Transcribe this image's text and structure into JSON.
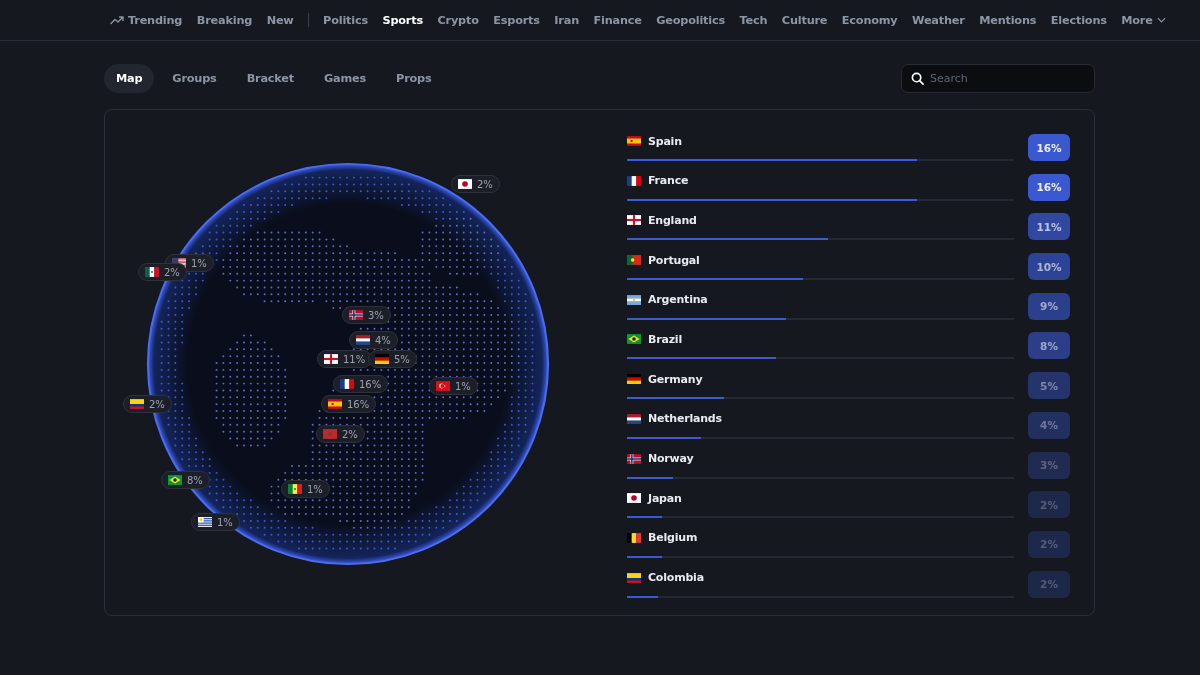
{
  "nav": [
    {
      "label": "Trending",
      "selected": false,
      "kind": "trending"
    },
    {
      "label": "Breaking",
      "selected": false
    },
    {
      "label": "New",
      "selected": false,
      "divider_after": true
    },
    {
      "label": "Politics",
      "selected": false
    },
    {
      "label": "Sports",
      "selected": true
    },
    {
      "label": "Crypto",
      "selected": false
    },
    {
      "label": "Esports",
      "selected": false
    },
    {
      "label": "Iran",
      "selected": false
    },
    {
      "label": "Finance",
      "selected": false
    },
    {
      "label": "Geopolitics",
      "selected": false
    },
    {
      "label": "Tech",
      "selected": false
    },
    {
      "label": "Culture",
      "selected": false
    },
    {
      "label": "Economy",
      "selected": false
    },
    {
      "label": "Weather",
      "selected": false
    },
    {
      "label": "Mentions",
      "selected": false
    },
    {
      "label": "Elections",
      "selected": false
    },
    {
      "label": "More",
      "selected": false,
      "kind": "more"
    }
  ],
  "tabs": [
    {
      "label": "Map",
      "selected": true
    },
    {
      "label": "Groups",
      "selected": false
    },
    {
      "label": "Bracket",
      "selected": false
    },
    {
      "label": "Games",
      "selected": false
    },
    {
      "label": "Props",
      "selected": false
    }
  ],
  "search": {
    "placeholder": "Search"
  },
  "markers": [
    {
      "kind": "japan",
      "value": "2%"
    },
    {
      "kind": "usa",
      "value": "1%"
    },
    {
      "kind": "mexico",
      "value": "2%"
    },
    {
      "kind": "norway",
      "value": "3%"
    },
    {
      "kind": "netherlands",
      "value": "4%"
    },
    {
      "kind": "england",
      "value": "11%"
    },
    {
      "kind": "germany",
      "value": "5%"
    },
    {
      "kind": "france",
      "value": "16%"
    },
    {
      "kind": "turkey",
      "value": "1%"
    },
    {
      "kind": "spain",
      "value": "16%"
    },
    {
      "kind": "colombia",
      "value": "2%"
    },
    {
      "kind": "morocco",
      "value": "2%"
    },
    {
      "kind": "brazil",
      "value": "8%"
    },
    {
      "kind": "senegal",
      "value": "1%"
    },
    {
      "kind": "uruguay",
      "value": "1%"
    }
  ],
  "outcomes": [
    {
      "kind": "spain",
      "name": "Spain",
      "level": 0.75,
      "value": "16%"
    },
    {
      "kind": "france",
      "name": "France",
      "level": 0.75,
      "value": "16%"
    },
    {
      "kind": "england",
      "name": "England",
      "level": 0.52,
      "value": "11%"
    },
    {
      "kind": "portugal",
      "name": "Portugal",
      "level": 0.455,
      "value": "10%"
    },
    {
      "kind": "argentina",
      "name": "Argentina",
      "level": 0.41,
      "value": "9%"
    },
    {
      "kind": "brazil",
      "name": "Brazil",
      "level": 0.385,
      "value": "8%"
    },
    {
      "kind": "germany",
      "name": "Germany",
      "level": 0.25,
      "value": "5%"
    },
    {
      "kind": "netherlands",
      "name": "Netherlands",
      "level": 0.19,
      "value": "4%"
    },
    {
      "kind": "norway",
      "name": "Norway",
      "level": 0.12,
      "value": "3%"
    },
    {
      "kind": "japan",
      "name": "Japan",
      "level": 0.09,
      "value": "2%"
    },
    {
      "kind": "belgium",
      "name": "Belgium",
      "level": 0.09,
      "value": "2%"
    },
    {
      "kind": "colombia",
      "name": "Colombia",
      "level": 0.08,
      "value": "2%"
    }
  ]
}
